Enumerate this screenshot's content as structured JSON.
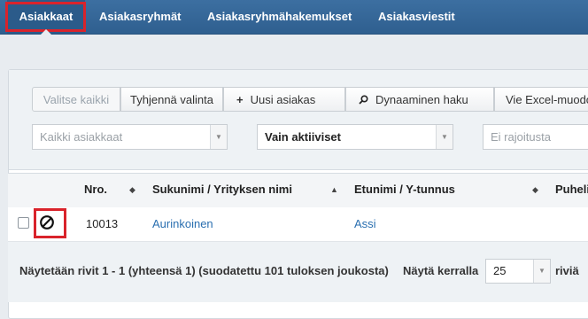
{
  "nav": {
    "items": [
      {
        "label": "Asiakkaat"
      },
      {
        "label": "Asiakasryhmät"
      },
      {
        "label": "Asiakasryhmähakemukset"
      },
      {
        "label": "Asiakasviestit"
      }
    ],
    "active": "Asiakkaat"
  },
  "toolbar": {
    "select_all": "Valitse kaikki",
    "clear_selection": "Tyhjennä valinta",
    "new_customer": "Uusi asiakas",
    "new_customer_icon": "plus-icon",
    "dynamic_search": "Dynaaminen haku",
    "dynamic_search_icon": "search-icon",
    "excel_export": "Vie Excel-muodossa"
  },
  "filters": {
    "customers_placeholder": "Kaikki asiakkaat",
    "status_value": "Vain aktiiviset",
    "restriction_placeholder": "Ei rajoitusta"
  },
  "table": {
    "columns": [
      "Nro.",
      "Sukunimi / Yrityksen nimi",
      "Etunimi / Y-tunnus",
      "Puhelin"
    ],
    "sorted_column": "Sukunimi / Yrityksen nimi",
    "rows": [
      {
        "status_icon": "ban-icon",
        "nro": "10013",
        "surname": "Aurinkoinen",
        "firstname": "Assi"
      }
    ]
  },
  "footer": {
    "summary": "Näytetään rivit 1 - 1 (yhteensä 1) (suodatettu 101 tuloksen joukosta)",
    "page_size_label": "Näytä kerralla",
    "page_size_value": "25",
    "page_size_suffix": "riviä"
  },
  "colors": {
    "navbar": "#2f5f8f",
    "highlight": "#d9232b",
    "link": "#2a6fb0"
  }
}
